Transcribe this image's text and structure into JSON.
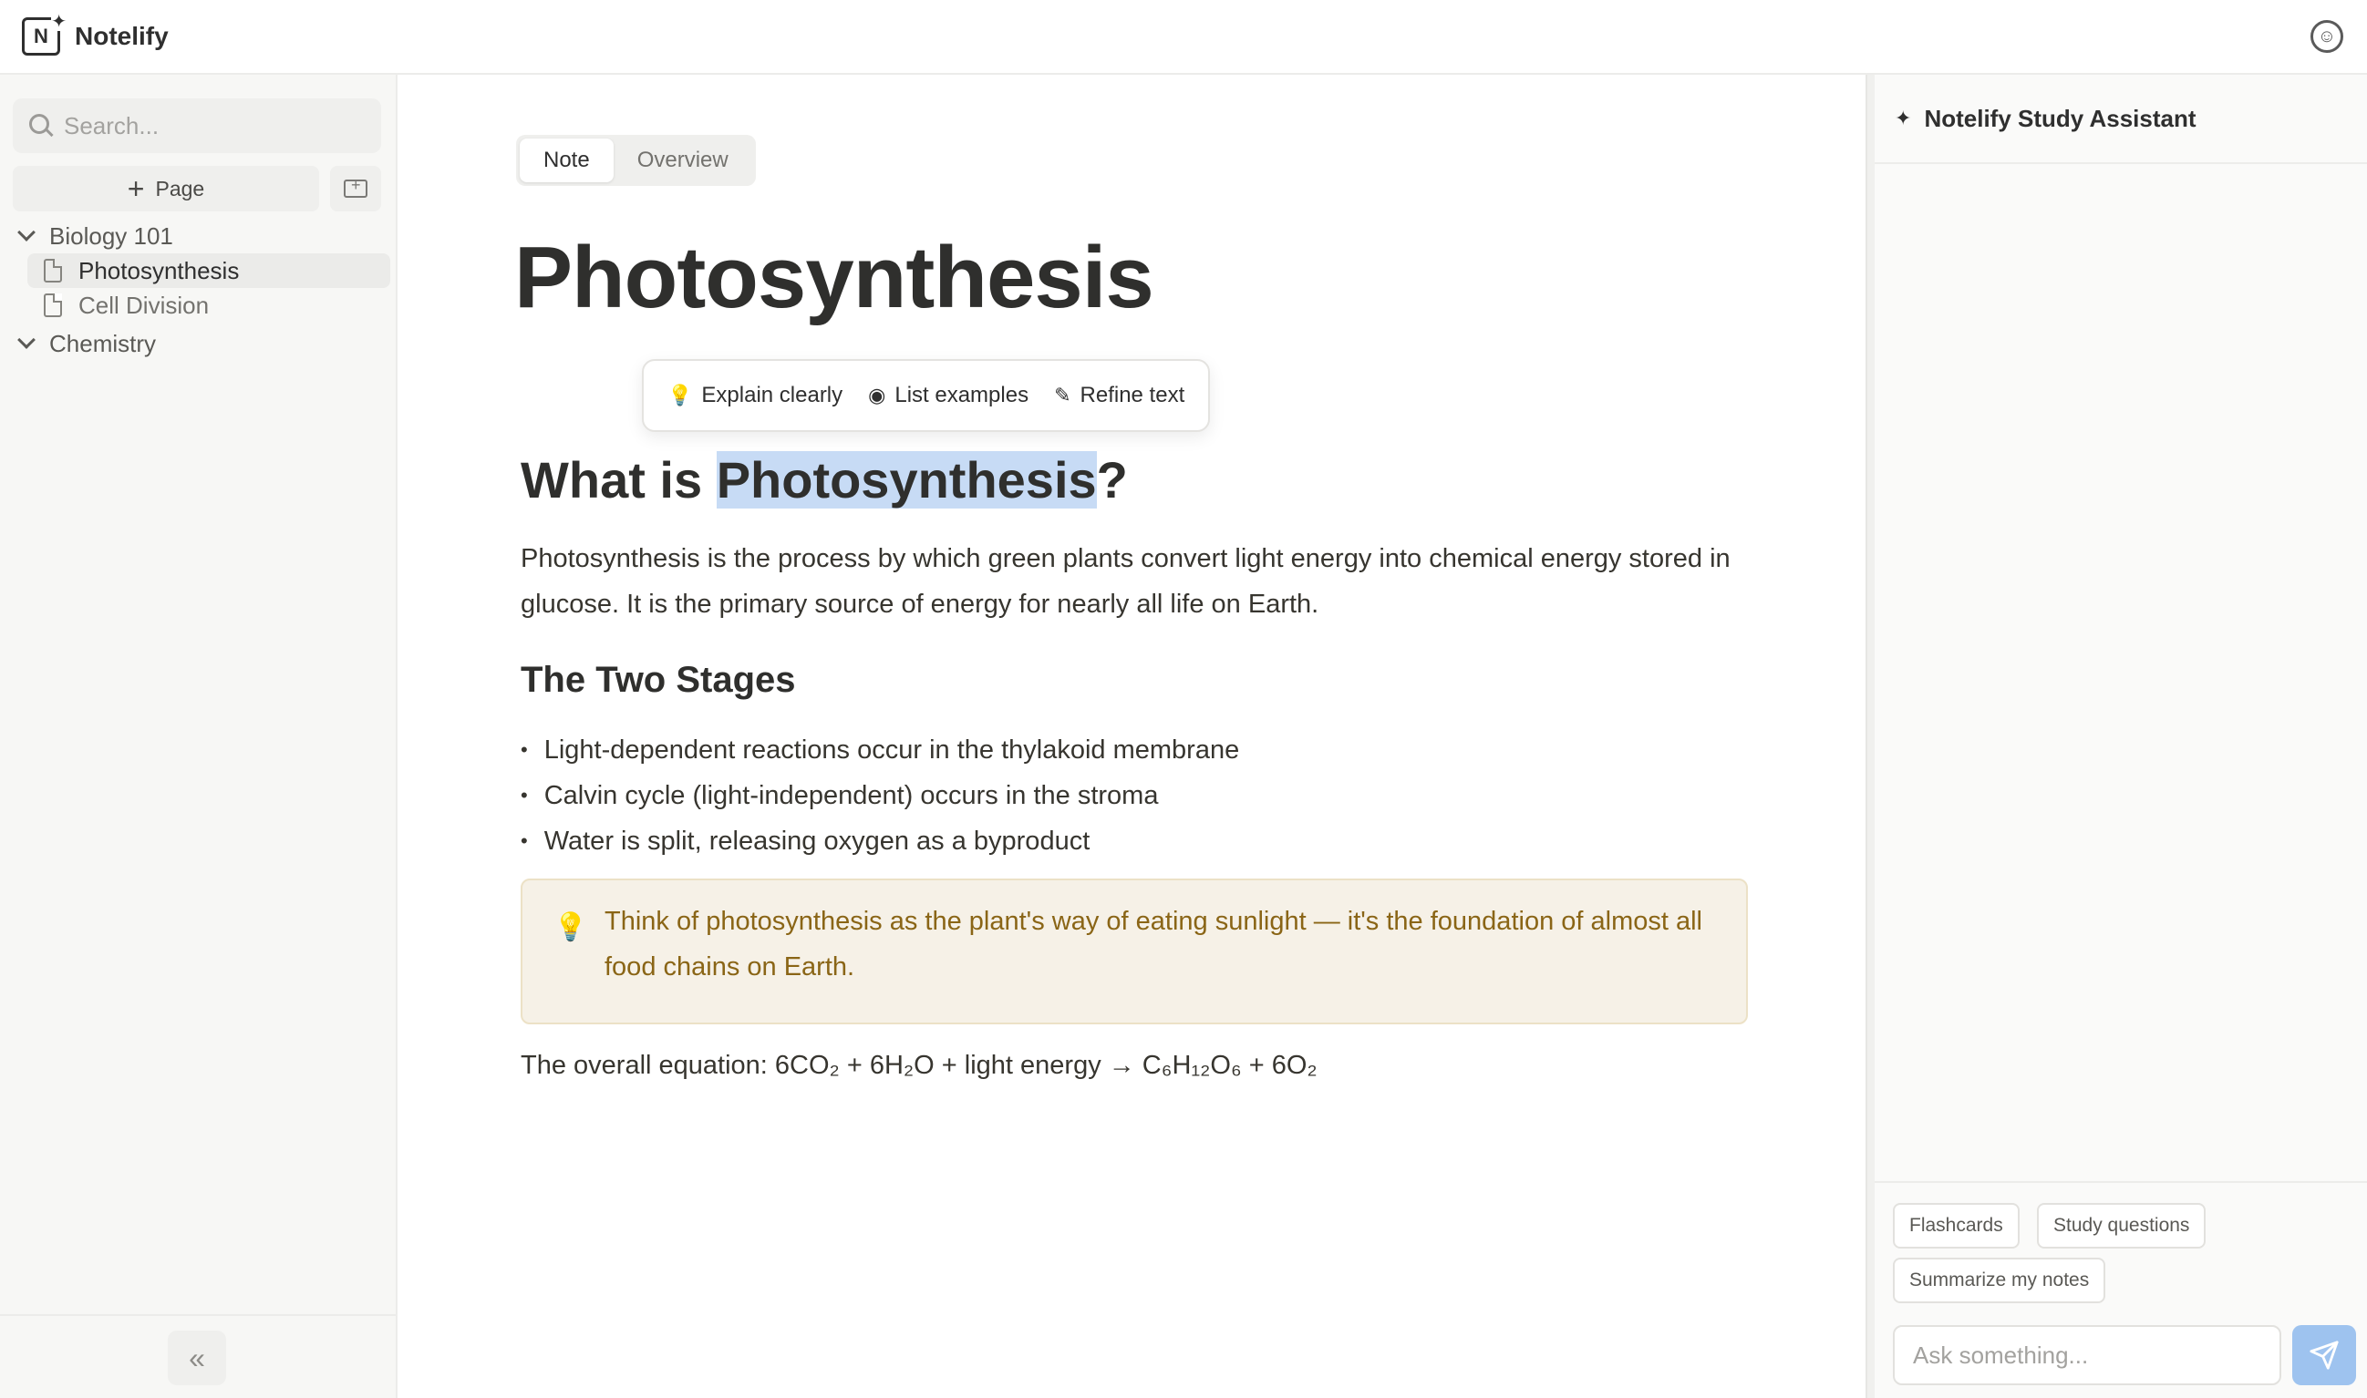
{
  "app": {
    "name": "Notelify",
    "logo_letter": "N"
  },
  "sidebar": {
    "search_placeholder": "Search...",
    "new_page_label": "Page",
    "tree": [
      {
        "label": "Biology 101",
        "children": [
          "Photosynthesis",
          "Cell Division"
        ]
      },
      {
        "label": "Chemistry",
        "children": []
      }
    ],
    "active_page": "Photosynthesis"
  },
  "main": {
    "tabs": [
      {
        "label": "Note",
        "active": true
      },
      {
        "label": "Overview",
        "active": false
      }
    ],
    "title": "Photosynthesis",
    "ai_toolbar": [
      {
        "label": "Explain clearly",
        "icon": "lightbulb-icon"
      },
      {
        "label": "List examples",
        "icon": "bullet-target-icon"
      },
      {
        "label": "Refine text",
        "icon": "pencil-icon"
      }
    ],
    "heading_prefix": "What is ",
    "heading_highlight": "Photosynthesis",
    "heading_suffix": "?",
    "intro": "Photosynthesis is the process by which green plants convert light energy into chemical energy stored in glucose. It is the primary source of energy for nearly all life on Earth.",
    "subheading": "The Two Stages",
    "bullets": [
      "Light-dependent reactions occur in the thylakoid membrane",
      "Calvin cycle (light-independent) occurs in the stroma",
      "Water is split, releasing oxygen as a byproduct"
    ],
    "callout": "Think of photosynthesis as the plant's way of eating sunlight — it's the foundation of almost all food chains on Earth.",
    "equation": "The overall equation: 6CO₂ + 6H₂O + light energy → C₆H₁₂O₆ + 6O₂"
  },
  "assistant": {
    "title": "Notelify Study Assistant",
    "chips": [
      "Flashcards",
      "Study questions",
      "Summarize my notes"
    ],
    "input_placeholder": "Ask something..."
  },
  "colors": {
    "highlight": "#c7dbf5",
    "callout_bg": "#f6f1e7",
    "callout_text": "#8a6516",
    "send_button": "#9ec3ef"
  }
}
